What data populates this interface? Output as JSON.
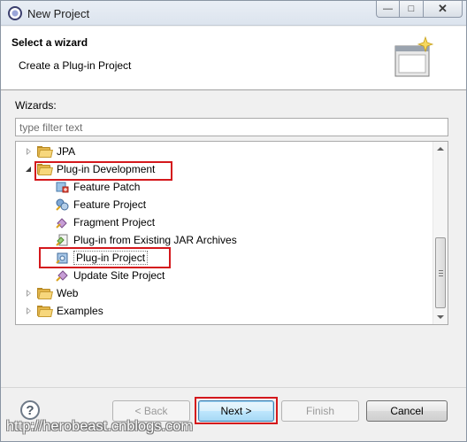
{
  "window": {
    "title": "New Project",
    "controls": {
      "minimize": "—",
      "maximize": "□",
      "close": "✕"
    }
  },
  "banner": {
    "title": "Select a wizard",
    "subtitle": "Create a Plug-in Project",
    "icon": "wizard-banner-icon"
  },
  "filter": {
    "label": "Wizards:",
    "placeholder": "type filter text",
    "value": ""
  },
  "tree": {
    "items": [
      {
        "label": "JPA",
        "icon": "folder-icon",
        "state": "collapsed"
      },
      {
        "label": "Plug-in Development",
        "icon": "folder-open-icon",
        "state": "expanded",
        "highlighted": true
      },
      {
        "label": "Feature Patch",
        "icon": "feature-patch-icon"
      },
      {
        "label": "Feature Project",
        "icon": "feature-project-icon"
      },
      {
        "label": "Fragment Project",
        "icon": "fragment-project-icon"
      },
      {
        "label": "Plug-in from Existing JAR Archives",
        "icon": "plugin-from-jar-icon"
      },
      {
        "label": "Plug-in Project",
        "icon": "plugin-project-icon",
        "selected": true,
        "highlighted": true
      },
      {
        "label": "Update Site Project",
        "icon": "update-site-icon"
      },
      {
        "label": "Web",
        "icon": "folder-icon",
        "state": "collapsed"
      },
      {
        "label": "Examples",
        "icon": "folder-icon",
        "state": "collapsed"
      }
    ]
  },
  "buttons": {
    "help": "?",
    "back": "< Back",
    "next": "Next >",
    "finish": "Finish",
    "cancel": "Cancel"
  },
  "watermark": "http://herobeast.cnblogs.com",
  "colors": {
    "highlight_box": "#d4181c",
    "default_button": "#3c7fb1"
  }
}
